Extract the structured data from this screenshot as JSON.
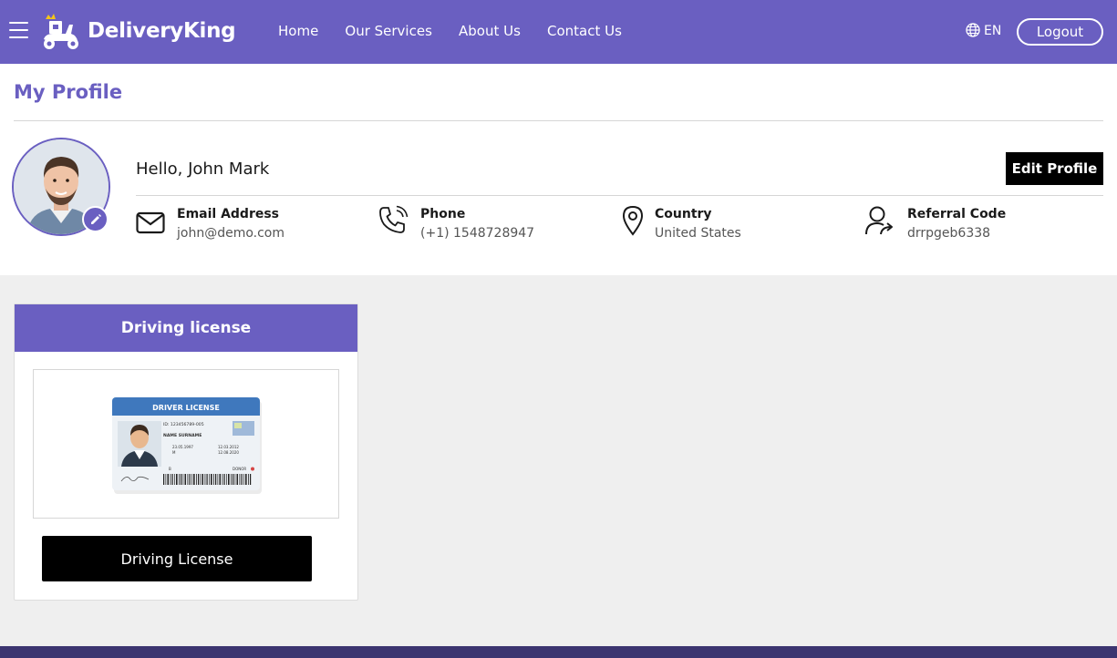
{
  "header": {
    "brand": "DeliveryKing",
    "nav": [
      "Home",
      "Our Services",
      "About Us",
      "Contact Us"
    ],
    "language": "EN",
    "logout_label": "Logout",
    "accent_color": "#6a5fc1"
  },
  "profile": {
    "page_title": "My Profile",
    "greeting": "Hello, John Mark",
    "edit_label": "Edit Profile",
    "details": [
      {
        "icon": "envelope-icon",
        "label": "Email Address",
        "value": "john@demo.com"
      },
      {
        "icon": "phone-icon",
        "label": "Phone",
        "value": "(+1) 1548728947"
      },
      {
        "icon": "location-pin-icon",
        "label": "Country",
        "value": "United States"
      },
      {
        "icon": "user-share-icon",
        "label": "Referral Code",
        "value": "drrpgeb6338"
      }
    ]
  },
  "license_card": {
    "header": "Driving license",
    "button_label": "Driving License",
    "card_image": {
      "title": "DRIVER LICENSE",
      "id_line": "ID: 123456789-005",
      "name_line": "NAME SURNAME",
      "dob": "23.05.1997",
      "issued": "12.03.2012",
      "expires": "12.08.2020",
      "sex": "M",
      "class": "B",
      "donor": "DONOR"
    }
  }
}
